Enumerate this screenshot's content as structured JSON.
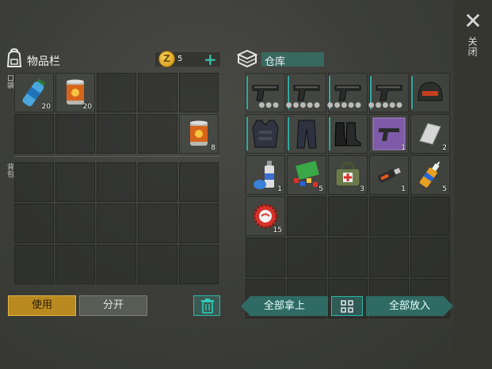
{
  "inventory": {
    "title": "物品栏",
    "coins": "5",
    "coin_symbol": "Z",
    "plus": "+",
    "pocket_label": "口袋",
    "backpack_label": "背包",
    "pocket_slots": [
      {
        "icon": "water-bottle-icon",
        "count": "20"
      },
      {
        "icon": "canned-food-icon",
        "count": "20"
      },
      {
        "icon": "",
        "count": ""
      },
      {
        "icon": "",
        "count": ""
      },
      {
        "icon": "",
        "count": ""
      },
      {
        "icon": "",
        "count": ""
      },
      {
        "icon": "",
        "count": ""
      },
      {
        "icon": "",
        "count": ""
      },
      {
        "icon": "",
        "count": ""
      },
      {
        "icon": "canned-food-icon",
        "count": "8"
      }
    ],
    "backpack_rows": 3,
    "backpack_cols": 5
  },
  "storage": {
    "title": "仓库",
    "slots": [
      {
        "icon": "pistol-icon",
        "count": "",
        "dots": "●●●"
      },
      {
        "icon": "pistol-icon",
        "count": "",
        "dots": "●●●●●"
      },
      {
        "icon": "pistol-icon",
        "count": "",
        "dots": "●●●●●"
      },
      {
        "icon": "pistol-icon",
        "count": "",
        "dots": "●●●●●"
      },
      {
        "icon": "helmet-icon",
        "count": "",
        "dots": ""
      },
      {
        "icon": "body-armor-icon",
        "count": "",
        "dots": ""
      },
      {
        "icon": "pants-icon",
        "count": "",
        "dots": ""
      },
      {
        "icon": "boots-icon",
        "count": "",
        "dots": ""
      },
      {
        "icon": "pistol-blueprint-icon",
        "count": "1",
        "dots": ""
      },
      {
        "icon": "metal-sheet-icon",
        "count": "2",
        "dots": ""
      },
      {
        "icon": "spray-can-icon",
        "count": "1",
        "dots": ""
      },
      {
        "icon": "toy-parts-icon",
        "count": "5",
        "dots": ""
      },
      {
        "icon": "first-aid-bag-icon",
        "count": "3",
        "dots": ""
      },
      {
        "icon": "usb-drive-icon",
        "count": "1",
        "dots": ""
      },
      {
        "icon": "glue-icon",
        "count": "5",
        "dots": ""
      },
      {
        "icon": "bottle-cap-icon",
        "count": "15",
        "dots": ""
      }
    ],
    "empty_slots": 14
  },
  "buttons": {
    "use": "使用",
    "split": "分开",
    "take_all": "全部拿上",
    "put_all": "全部放入"
  },
  "close": {
    "icon": "close-icon",
    "label": "关闭"
  },
  "colors": {
    "accent_teal": "#2bb8a5",
    "use_button": "#b98a20",
    "coin_gold": "#f2c13a"
  }
}
